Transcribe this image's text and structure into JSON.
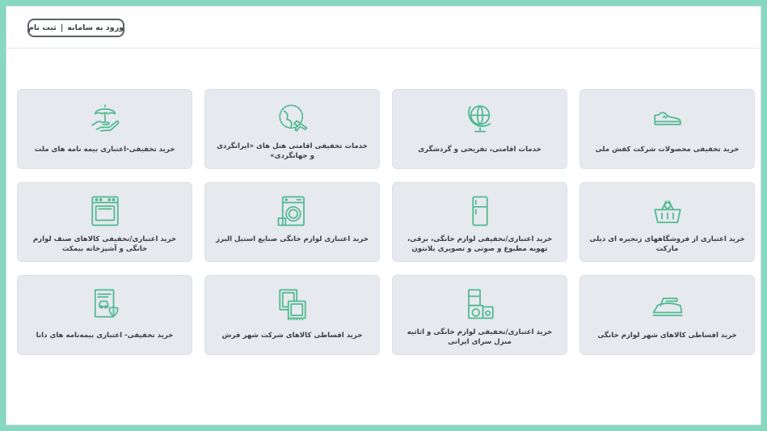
{
  "header": {
    "login_label": "ورود به سامانه",
    "separator": "|",
    "register_label": "ثبت نام"
  },
  "accent_color": "#86d8be",
  "icon_color": "#4fb98f",
  "cards": [
    {
      "label": "خرید تخفیفی محصولات شرکت کفش ملی",
      "icon": "sneaker-icon"
    },
    {
      "label": "خدمات اقامتی، تفریحی و گردشگری",
      "icon": "globe-icon"
    },
    {
      "label": "خدمات تخفیفی اقامتی هتل های «ایرانگردی و جهانگردی»",
      "icon": "travel-plane-icon"
    },
    {
      "label": "خرید تخفیفی-اعتباری بیمه نامه های ملت",
      "icon": "umbrella-hand-icon"
    },
    {
      "label": "خرید اعتباری از فروشگاههای زنجیره ای دیلی مارکت",
      "icon": "shopping-basket-icon"
    },
    {
      "label": "خرید اعتباری/تخفیفی لوازم خانگی، برقی، تهویه مطبوع و صوتی و تصویری بلانتون",
      "icon": "refrigerator-icon"
    },
    {
      "label": "خرید اعتباری لوازم خانگی صنایع استیل البرز",
      "icon": "washing-machine-icon"
    },
    {
      "label": "خرید اعتباری/تخفیفی کالاهای صنف لوازم خانگی و آشپزخانه بیمکث",
      "icon": "oven-icon"
    },
    {
      "label": "خرید اقساطی کالاهای شهر لوازم خانگی",
      "icon": "iron-icon"
    },
    {
      "label": "خرید اعتباری/تخفیفی لوازم خانگی و اثاثیه منزل سرای ایرانی",
      "icon": "appliances-icon"
    },
    {
      "label": "خرید اقساطی کالاهای شرکت شهر فرش",
      "icon": "carpet-icon"
    },
    {
      "label": "خرید تخفیفی- اعتباری بیمه‌نامه های دانا",
      "icon": "insurance-document-icon"
    }
  ]
}
